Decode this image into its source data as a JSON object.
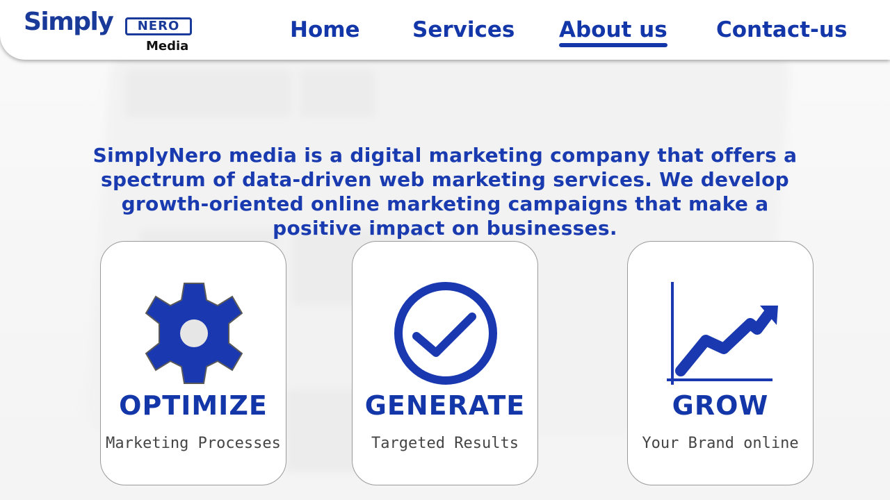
{
  "logo": {
    "word": "Simply",
    "badge": "NERO",
    "sub": "Media"
  },
  "nav": {
    "items": [
      {
        "label": "Home",
        "active": false
      },
      {
        "label": "Services",
        "active": false
      },
      {
        "label": "About us",
        "active": true
      },
      {
        "label": "Contact-us",
        "active": false
      }
    ]
  },
  "intro": {
    "text": "SimplyNero media is a digital marketing company that offers a spectrum of data-driven web marketing services. We develop growth-oriented online marketing campaigns that make a positive impact on businesses."
  },
  "cards": [
    {
      "icon": "gear-icon",
      "title": "OPTIMIZE",
      "subtitle": "Marketing Processes"
    },
    {
      "icon": "check-circle-icon",
      "title": "GENERATE",
      "subtitle": "Targeted Results"
    },
    {
      "icon": "growth-chart-icon",
      "title": "GROW",
      "subtitle": "Your Brand online"
    }
  ],
  "colors": {
    "brand": "#1336a8",
    "icon_fill": "#1a39b0"
  }
}
